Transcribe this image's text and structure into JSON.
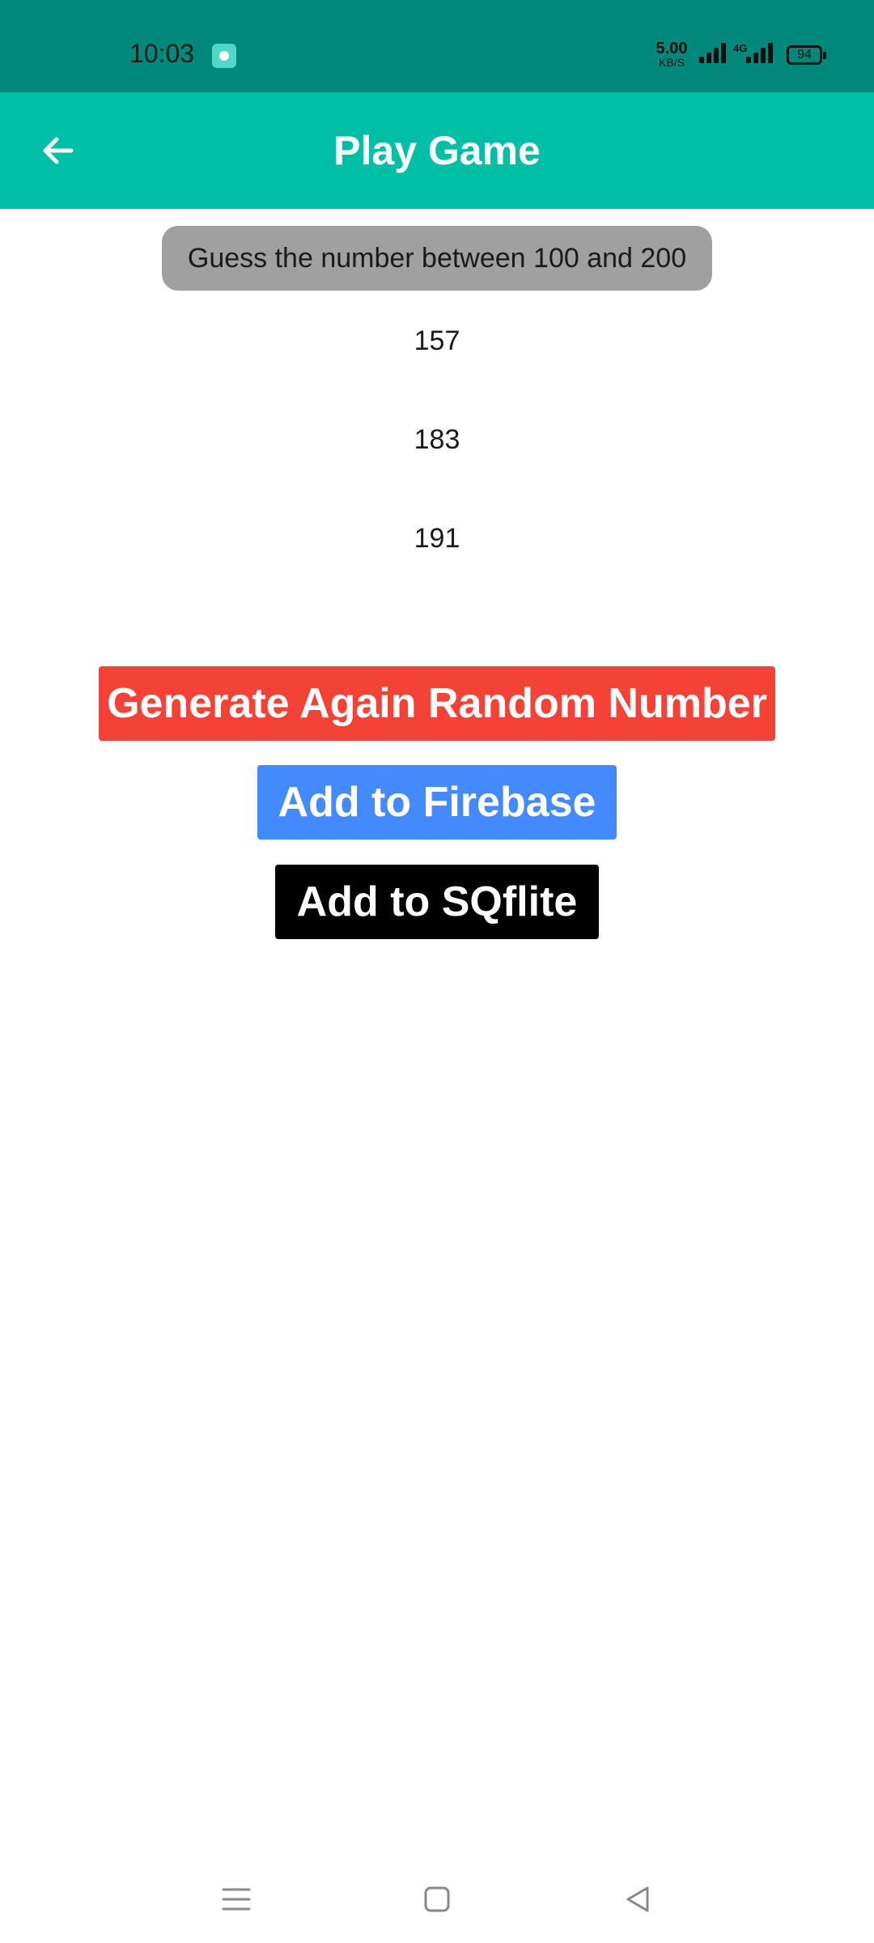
{
  "status_bar": {
    "time": "10:03",
    "net_speed_value": "5.00",
    "net_speed_unit": "KB/S",
    "network_type": "4G",
    "battery_level": "94"
  },
  "app_bar": {
    "title": "Play Game",
    "back_icon": "arrow-left-icon"
  },
  "game": {
    "prompt": "Guess the number between 100 and 200",
    "numbers": [
      "157",
      "183",
      "191"
    ]
  },
  "actions": {
    "generate_label": "Generate Again Random Number",
    "firebase_label": "Add to Firebase",
    "sqflite_label": "Add to SQflite"
  },
  "nav_bar": {
    "icons": [
      "menu-icon",
      "home-icon",
      "back-triangle-icon"
    ]
  },
  "colors": {
    "status_bar": "#00897b",
    "app_bar": "#00bfa5",
    "generate_button": "#f44336",
    "firebase_button": "#448aff",
    "sqflite_button": "#000000",
    "prompt_chip": "#a0a0a0"
  }
}
